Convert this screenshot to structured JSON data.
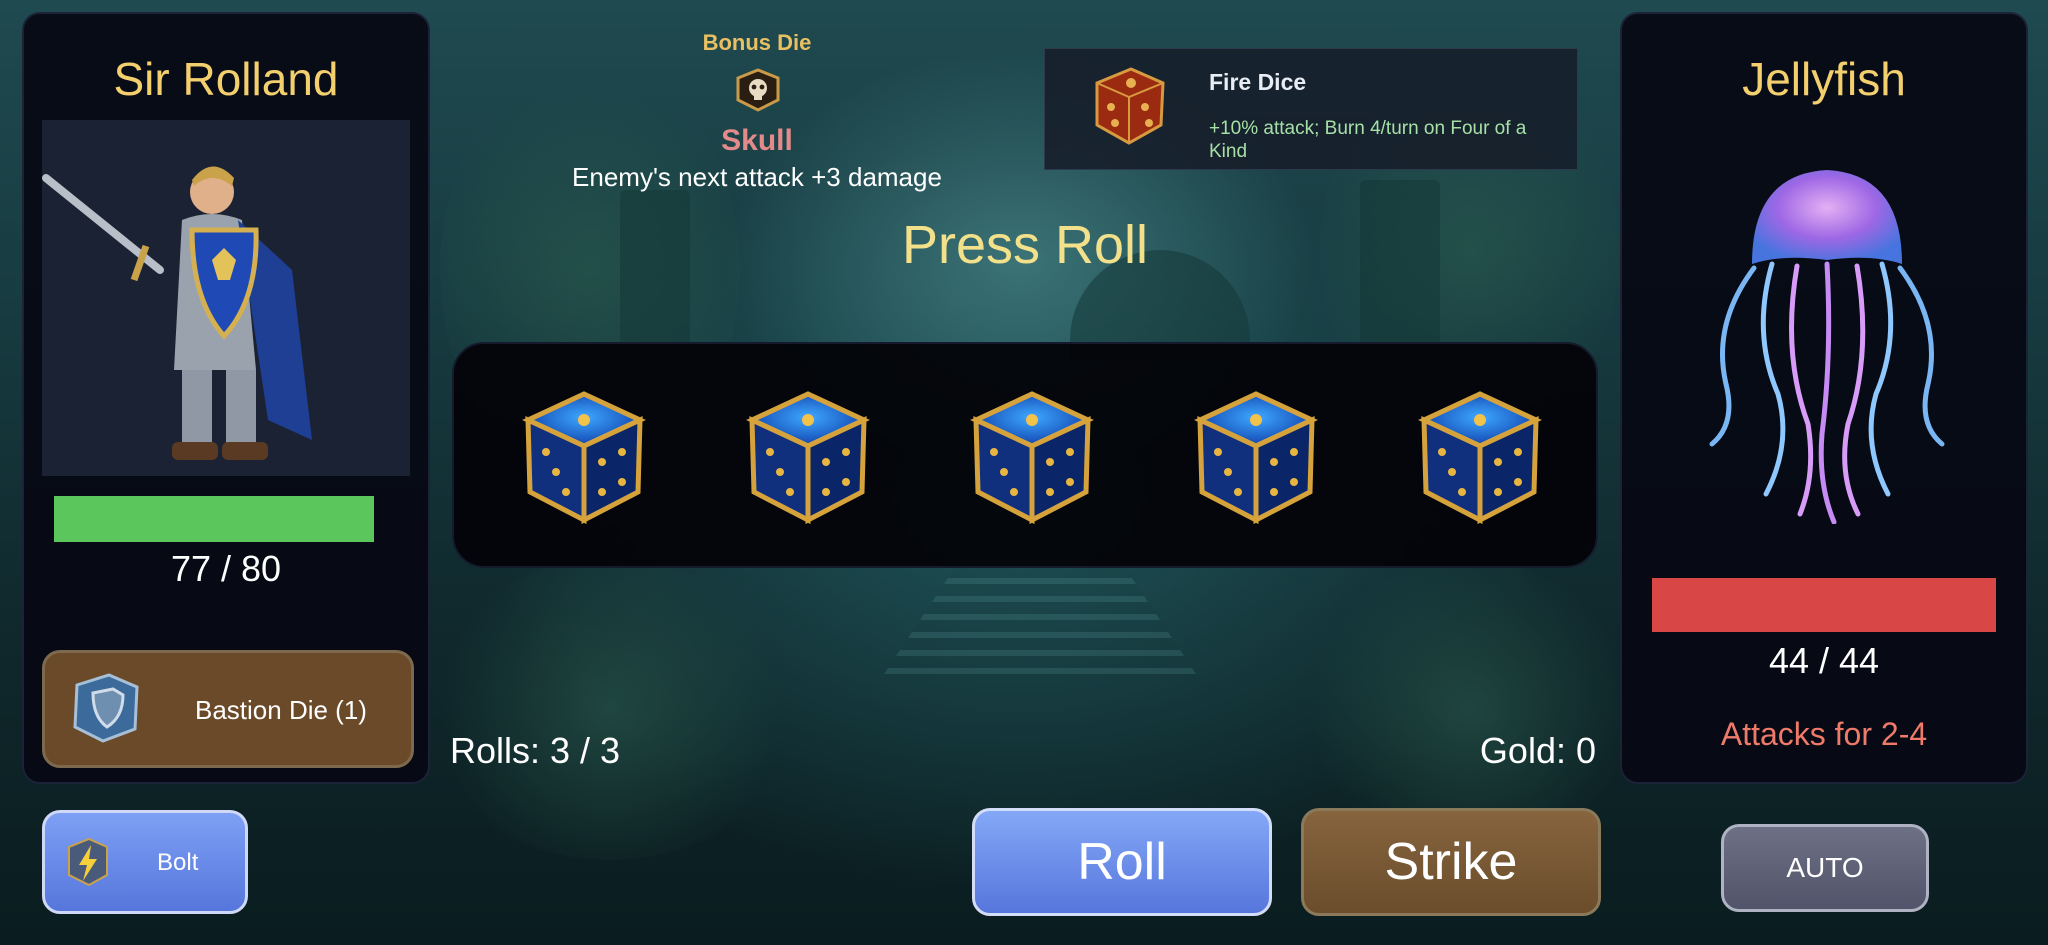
{
  "player": {
    "name": "Sir Rolland",
    "hp_text": "77 / 80",
    "hp_fraction": 0.9625,
    "hp_color": "#5bc65b",
    "item": {
      "label": "Bastion Die (1)",
      "icon": "shield-die-icon"
    }
  },
  "enemy": {
    "name": "Jellyfish",
    "hp_text": "44 / 44",
    "hp_fraction": 1.0,
    "hp_color": "#d84646",
    "attack_text": "Attacks for 2-4"
  },
  "bonus_die": {
    "title": "Bonus Die",
    "name": "Skull",
    "description": "Enemy's next attack +3 damage",
    "icon": "skull-die-icon"
  },
  "fire_card": {
    "title": "Fire Dice",
    "description": "+10% attack; Burn 4/turn on Four of a Kind",
    "icon": "fire-die-icon"
  },
  "status_text": "Press Roll",
  "dice": [
    {
      "name": "die-1",
      "icon": "blue-gold-die-icon"
    },
    {
      "name": "die-2",
      "icon": "blue-gold-die-icon"
    },
    {
      "name": "die-3",
      "icon": "blue-gold-die-icon"
    },
    {
      "name": "die-4",
      "icon": "blue-gold-die-icon"
    },
    {
      "name": "die-5",
      "icon": "blue-gold-die-icon"
    }
  ],
  "rolls_text": "Rolls: 3 / 3",
  "gold_text": "Gold: 0",
  "buttons": {
    "bolt": "Bolt",
    "roll": "Roll",
    "strike": "Strike",
    "auto": "AUTO"
  }
}
